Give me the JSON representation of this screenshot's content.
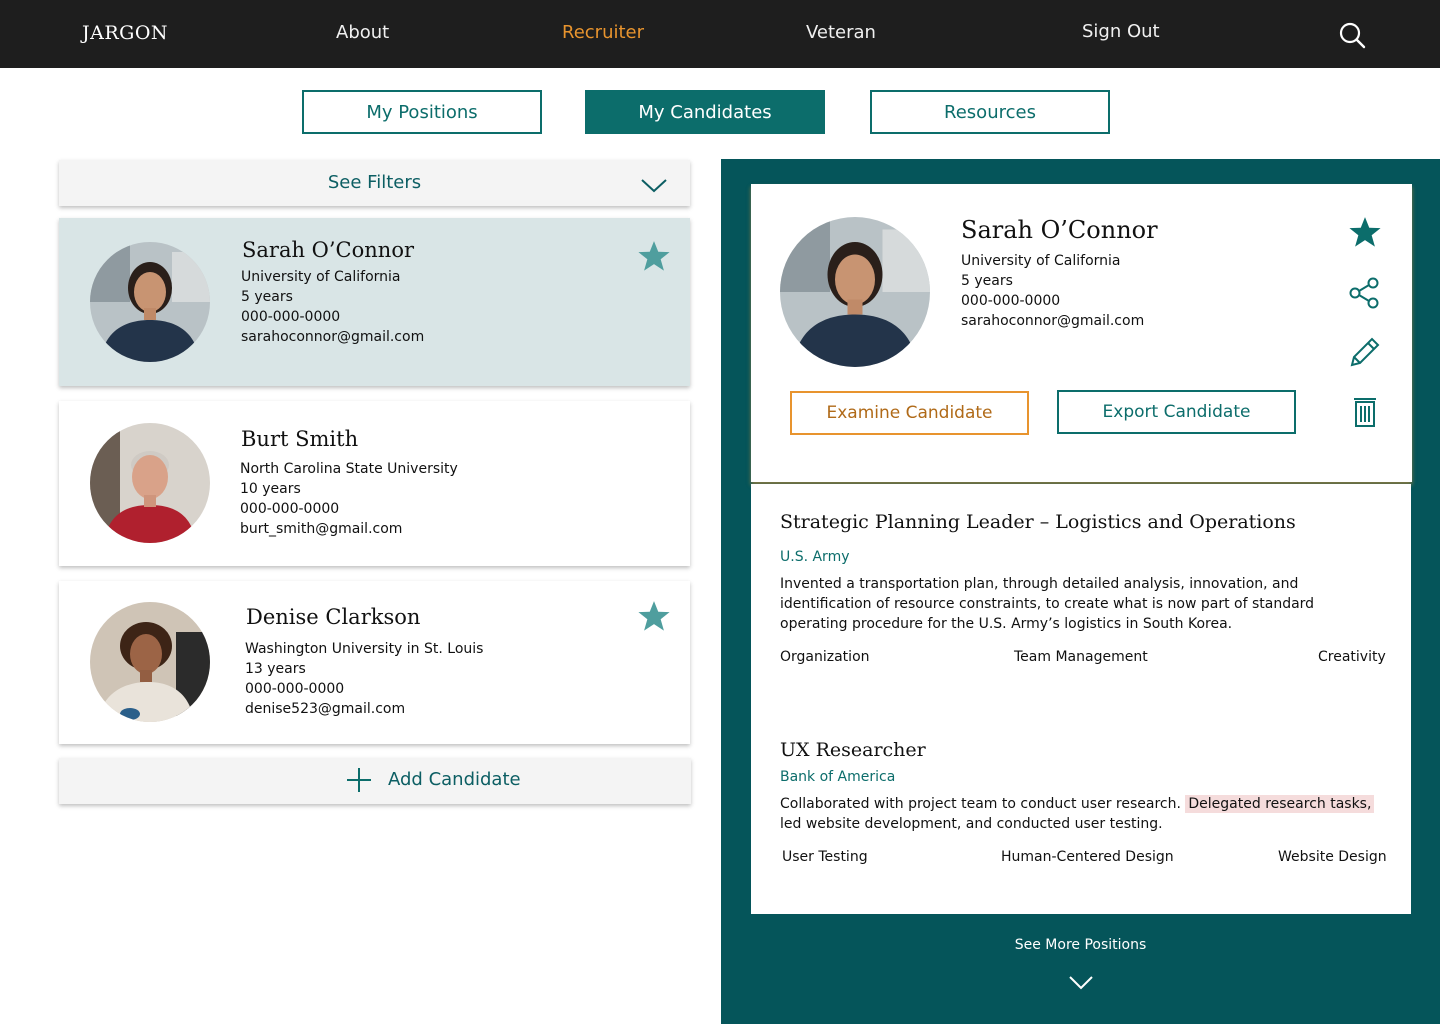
{
  "nav": {
    "brand": "JARGON",
    "links": [
      "About",
      "Recruiter",
      "Veteran",
      "Sign Out"
    ],
    "active": "Recruiter",
    "search_icon": "search-icon"
  },
  "tabs": [
    "My Positions",
    "My Candidates",
    "Resources"
  ],
  "active_tab": "My Candidates",
  "filters": {
    "label": "See Filters"
  },
  "candidates": [
    {
      "name": "Sarah O’Connor",
      "school": "University of California",
      "experience": "5 years",
      "phone": "000-000-0000",
      "email": "sarahoconnor@gmail.com",
      "starred": true,
      "selected": true
    },
    {
      "name": "Burt Smith",
      "school": "North Carolina State University",
      "experience": "10 years",
      "phone": "000-000-0000",
      "email": "burt_smith@gmail.com",
      "starred": false,
      "selected": false
    },
    {
      "name": "Denise Clarkson",
      "school": "Washington University in St. Louis",
      "experience": "13 years",
      "phone": "000-000-0000",
      "email": "denise523@gmail.com",
      "starred": true,
      "selected": false
    }
  ],
  "add_candidate": "Add Candidate",
  "detail": {
    "name": "Sarah O’Connor",
    "school": "University of California",
    "experience": "5 years",
    "phone": "000-000-0000",
    "email": "sarahoconnor@gmail.com",
    "examine_label": "Examine Candidate",
    "export_label": "Export Candidate",
    "actions": [
      "star-icon",
      "share-icon",
      "pencil-icon",
      "trash-icon"
    ],
    "positions": [
      {
        "title": "Strategic Planning Leader – Logistics and Operations",
        "org": "U.S. Army",
        "desc_lines": [
          "Invented a transportation plan, through detailed analysis, innovation, and",
          "identification of resource constraints, to create what is now part of standard",
          "operating procedure for the U.S. Army’s logistics in South Korea."
        ],
        "skills": [
          "Organization",
          "Team Management",
          "Creativity"
        ]
      },
      {
        "title": "UX Researcher",
        "org": "Bank of America",
        "desc_line1": "Collaborated with project team to conduct user research.",
        "desc_highlight": "Delegated research tasks,",
        "desc_line2": "led website development, and conducted user testing.",
        "skills": [
          "User Testing",
          "Human-Centered Design",
          "Website Design"
        ]
      }
    ],
    "see_more": "See More Positions"
  },
  "colors": {
    "teal": "#0c6d6b",
    "dark_teal": "#05555a",
    "orange": "#e8942e",
    "star": "#4f9e9e",
    "highlight": "#f5dcdc"
  }
}
